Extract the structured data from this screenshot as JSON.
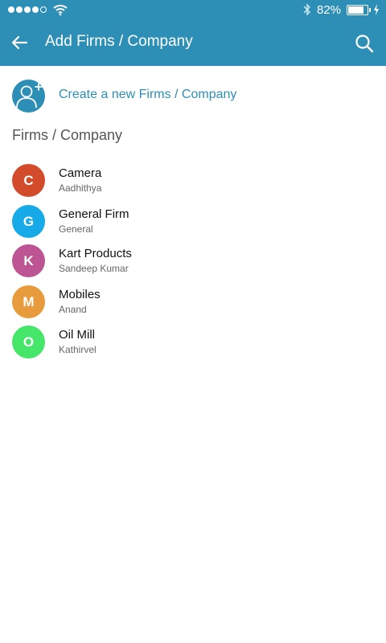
{
  "status_bar": {
    "battery_percent": "82%",
    "battery_level": 0.82,
    "signal_bars_filled": 4,
    "signal_bars_total": 5,
    "icons": [
      "signal-dots-icon",
      "wifi-icon",
      "bluetooth-icon",
      "battery-icon",
      "charging-bolt-icon"
    ]
  },
  "app_bar": {
    "title": "Add Firms / Company",
    "back_icon": "arrow-left-icon",
    "search_icon": "search-icon",
    "color": "#2d8fb6"
  },
  "create": {
    "label": "Create a new Firms / Company",
    "icon": "add-user-icon"
  },
  "section": {
    "title": "Firms / Company"
  },
  "firms": [
    {
      "initial": "C",
      "name": "Camera",
      "subtitle": "Aadhithya",
      "color": "#d24b2b"
    },
    {
      "initial": "G",
      "name": "General Firm",
      "subtitle": "General",
      "color": "#16aae8"
    },
    {
      "initial": "K",
      "name": "Kart Products",
      "subtitle": "Sandeep Kumar",
      "color": "#bd5594"
    },
    {
      "initial": "M",
      "name": "Mobiles",
      "subtitle": "Anand",
      "color": "#e89b3c"
    },
    {
      "initial": "O",
      "name": "Oil Mill",
      "subtitle": "Kathirvel",
      "color": "#46e66b"
    }
  ]
}
